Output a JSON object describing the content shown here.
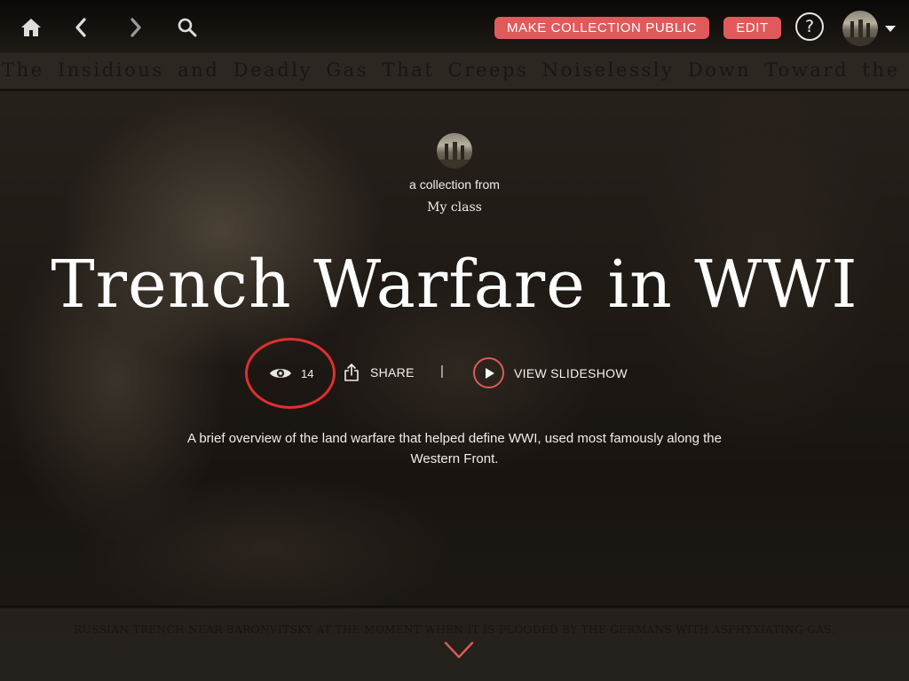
{
  "toolbar": {
    "home_icon": "home-icon",
    "back_icon": "chevron-left-icon",
    "forward_icon": "chevron-right-icon",
    "search_icon": "search-icon",
    "make_public_label": "MAKE COLLECTION PUBLIC",
    "edit_label": "EDIT",
    "help_label": "?",
    "user_menu_icon": "caret-down-icon",
    "accent_color": "#e05a5b"
  },
  "background": {
    "caption_top": "The Insidious and Deadly Gas That Creeps Noiselessly Down Toward the Foe",
    "caption_bottom": "RUSSIAN TRENCH NEAR BARONVITSKY AT THE MOMENT WHEN IT IS FLOODED BY THE GERMANS WITH ASPHYXIATING GAS."
  },
  "collection": {
    "from_label": "a collection from",
    "owner": "My class",
    "title": "Trench Warfare in WWI",
    "views": "14",
    "share_label": "SHARE",
    "divider": "|",
    "slideshow_label": "VIEW SLIDESHOW",
    "description": "A brief overview of the land warfare that helped define WWI, used most famously along the Western Front."
  },
  "annotation": {
    "highlight_color": "#e02f2f"
  }
}
